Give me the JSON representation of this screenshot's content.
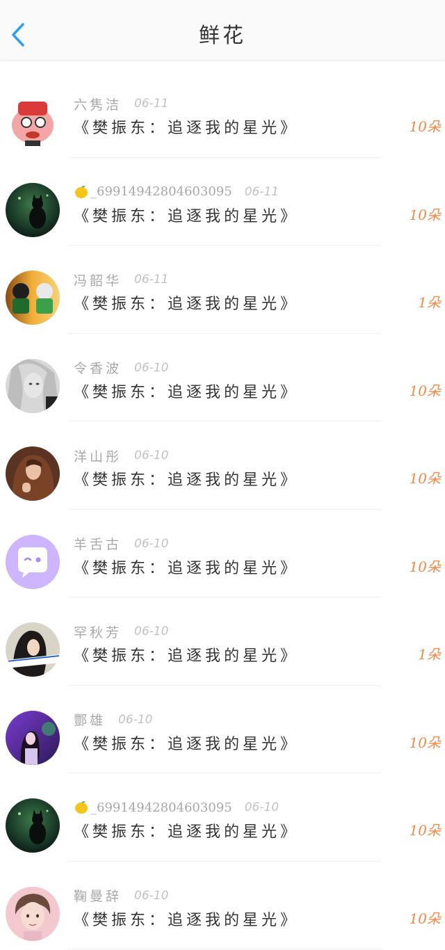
{
  "header": {
    "title": "鲜花",
    "back_icon": "chevron-left-icon",
    "accent_color": "#2e9cf0"
  },
  "flowers": [
    {
      "user": "六隽洁",
      "date": "06-11",
      "item": "《樊振东：追逐我的星光》",
      "count": "10朵",
      "lemon_badge": false,
      "avatar": "cartoon-character"
    },
    {
      "user": "_6991494280460309​5",
      "date": "06-11",
      "item": "《樊振东：追逐我的星光》",
      "count": "10朵",
      "lemon_badge": true,
      "avatar": "dark-cat"
    },
    {
      "user": "冯韶华",
      "date": "06-11",
      "item": "《樊振东：追逐我的星光》",
      "count": "1朵",
      "lemon_badge": false,
      "avatar": "toy-figures"
    },
    {
      "user": "令香波",
      "date": "06-10",
      "item": "《樊振东：追逐我的星光》",
      "count": "10朵",
      "lemon_badge": false,
      "avatar": "bw-portrait"
    },
    {
      "user": "洋山彤",
      "date": "06-10",
      "item": "《樊振东：追逐我的星光》",
      "count": "10朵",
      "lemon_badge": false,
      "avatar": "long-hair-girl"
    },
    {
      "user": "羊舌古",
      "date": "06-10",
      "item": "《樊振东：追逐我的星光》",
      "count": "10朵",
      "lemon_badge": false,
      "avatar": "purple-chat-bubble"
    },
    {
      "user": "罕秋芳",
      "date": "06-10",
      "item": "《樊振东：追逐我的星光》",
      "count": "1朵",
      "lemon_badge": false,
      "avatar": "girl-with-sign"
    },
    {
      "user": "酆雄",
      "date": "06-10",
      "item": "《樊振东：追逐我的星光》",
      "count": "10朵",
      "lemon_badge": false,
      "avatar": "purple-room-girl"
    },
    {
      "user": "_69914942804603095",
      "date": "06-10",
      "item": "《樊振东：追逐我的星光》",
      "count": "10朵",
      "lemon_badge": true,
      "avatar": "dark-cat"
    },
    {
      "user": "鞠曼辞",
      "date": "06-10",
      "item": "《樊振东：追逐我的星光》",
      "count": "10朵",
      "lemon_badge": false,
      "avatar": "illustrated-boy"
    }
  ]
}
